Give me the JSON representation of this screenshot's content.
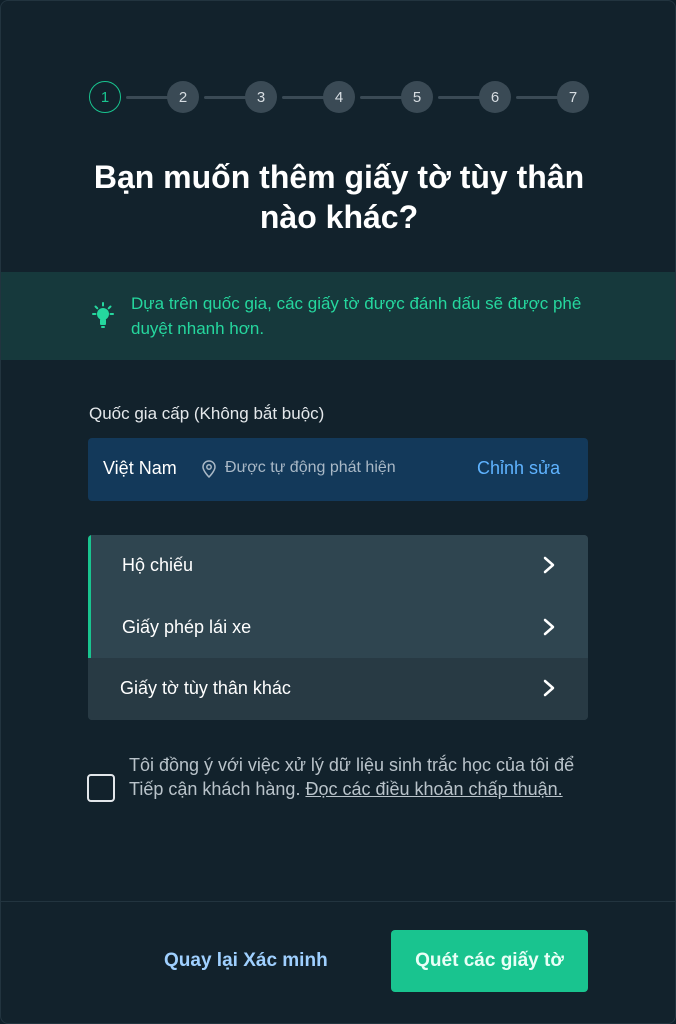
{
  "stepper": {
    "steps": [
      "1",
      "2",
      "3",
      "4",
      "5",
      "6",
      "7"
    ],
    "active_index": 0
  },
  "title": "Bạn muốn thêm giấy tờ tùy thân nào khác?",
  "info": {
    "icon": "lightbulb-icon",
    "text": "Dựa trên quốc gia, các giấy tờ được đánh dấu sẽ được phê duyệt nhanh hơn."
  },
  "country": {
    "label": "Quốc gia cấp (Không bắt buộc)",
    "name": "Việt Nam",
    "auto_detected": "Được tự động phát hiện",
    "edit_label": "Chỉnh sửa"
  },
  "documents": [
    {
      "label": "Hộ chiếu",
      "marked": true
    },
    {
      "label": "Giấy phép lái xe",
      "marked": true
    },
    {
      "label": "Giấy tờ tùy thân khác",
      "marked": false
    }
  ],
  "consent": {
    "checked": false,
    "text": "Tôi đồng ý với việc xử lý dữ liệu sinh trắc học của tôi để Tiếp cận khách hàng. ",
    "link": "Đọc các điều khoản chấp thuận."
  },
  "footer": {
    "back_label": "Quay lại Xác minh",
    "scan_label": "Quét các giấy tờ"
  },
  "colors": {
    "accent": "#19c48f",
    "link": "#5fb3ff",
    "background": "#12222c"
  }
}
